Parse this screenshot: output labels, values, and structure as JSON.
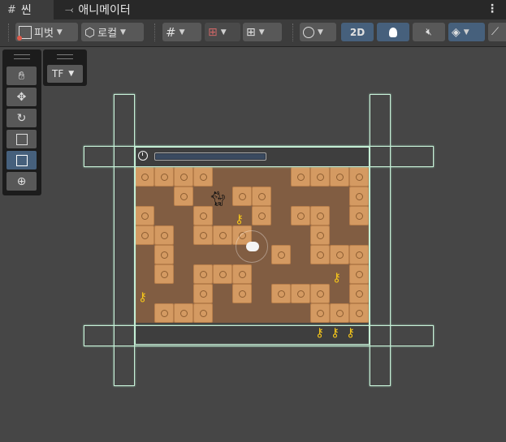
{
  "tabs": [
    {
      "label": "씬",
      "icon": "grid-icon"
    },
    {
      "label": "애니메이터",
      "icon": "animator-icon"
    }
  ],
  "toolbar": {
    "pivot_label": "피벗",
    "local_label": "로컬",
    "mode_2d_label": "2D"
  },
  "tools": [
    "hand-tool",
    "move-tool",
    "rotate-tool",
    "scale-tool",
    "rect-tool",
    "transform-tool"
  ],
  "active_tool": "rect-tool",
  "tf_panel": {
    "label": "TF"
  },
  "colors": {
    "board": "#815d42",
    "block": "#d49a62",
    "key": "#f4c51a",
    "accent": "#46607c",
    "bounds": "#c8f0d8"
  },
  "game": {
    "key_counter_icons": 3,
    "timer_fraction": 1.0,
    "blocks_grid": [
      [
        0,
        0
      ],
      [
        1,
        0
      ],
      [
        2,
        0
      ],
      [
        3,
        0
      ],
      [
        8,
        0
      ],
      [
        9,
        0
      ],
      [
        10,
        0
      ],
      [
        11,
        0
      ],
      [
        2,
        1
      ],
      [
        5,
        1
      ],
      [
        6,
        1
      ],
      [
        11,
        1
      ],
      [
        0,
        2
      ],
      [
        3,
        2
      ],
      [
        6,
        2
      ],
      [
        8,
        2
      ],
      [
        9,
        2
      ],
      [
        11,
        2
      ],
      [
        0,
        3
      ],
      [
        1,
        3
      ],
      [
        3,
        3
      ],
      [
        4,
        3
      ],
      [
        5,
        3
      ],
      [
        9,
        3
      ],
      [
        1,
        4
      ],
      [
        7,
        4
      ],
      [
        9,
        4
      ],
      [
        10,
        4
      ],
      [
        11,
        4
      ],
      [
        1,
        5
      ],
      [
        3,
        5
      ],
      [
        4,
        5
      ],
      [
        5,
        5
      ],
      [
        11,
        5
      ],
      [
        3,
        6
      ],
      [
        5,
        6
      ],
      [
        7,
        6
      ],
      [
        8,
        6
      ],
      [
        9,
        6
      ],
      [
        11,
        6
      ],
      [
        1,
        7
      ],
      [
        2,
        7
      ],
      [
        3,
        7
      ],
      [
        9,
        7
      ],
      [
        10,
        7
      ],
      [
        11,
        7
      ]
    ]
  }
}
